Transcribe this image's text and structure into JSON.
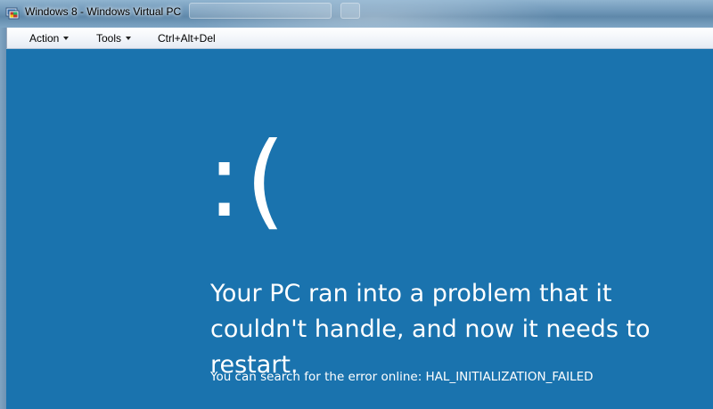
{
  "window": {
    "title": "Windows 8 - Windows Virtual PC",
    "icon": "virtual-pc-icon"
  },
  "menubar": {
    "items": [
      {
        "label": "Action",
        "has_dropdown": true
      },
      {
        "label": "Tools",
        "has_dropdown": true
      },
      {
        "label": "Ctrl+Alt+Del",
        "has_dropdown": false
      }
    ]
  },
  "bsod": {
    "face": ":(",
    "message": "Your PC ran into a problem that it couldn't handle, and now it needs to restart.",
    "error_line": "You can search for the error online: HAL_INITIALIZATION_FAILED",
    "background_color": "#1a73ae",
    "text_color": "#ffffff"
  }
}
